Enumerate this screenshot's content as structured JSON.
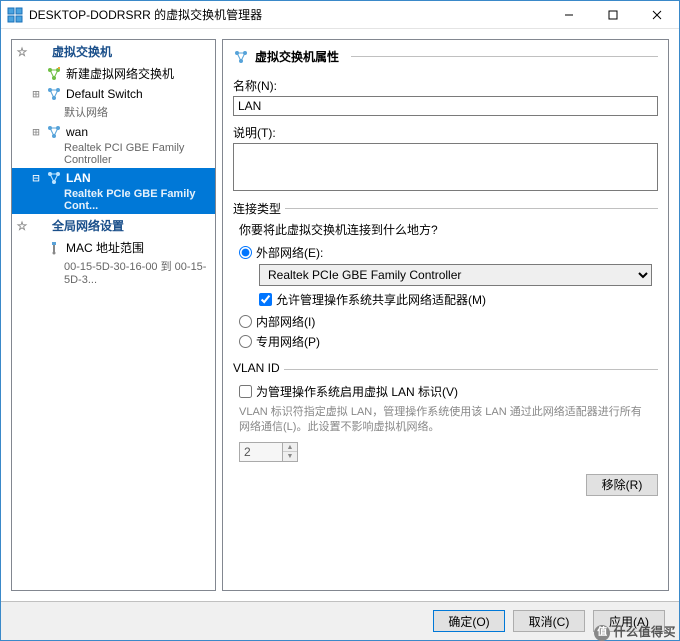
{
  "window": {
    "title": "DESKTOP-DODRSRR 的虚拟交换机管理器"
  },
  "tree": {
    "vswitch_header": "虚拟交换机",
    "new_vswitch": "新建虚拟网络交换机",
    "default_switch": "Default Switch",
    "default_switch_sub": "默认网络",
    "wan": "wan",
    "wan_sub": "Realtek PCI GBE Family Controller",
    "lan": "LAN",
    "lan_sub": "Realtek PCIe GBE Family Cont...",
    "global_header": "全局网络设置",
    "mac_range": "MAC 地址范围",
    "mac_range_sub": "00-15-5D-30-16-00 到 00-15-5D-3..."
  },
  "props": {
    "section_title": "虚拟交换机属性",
    "name_label": "名称(N):",
    "name_value": "LAN",
    "desc_label": "说明(T):",
    "desc_value": ""
  },
  "conn": {
    "legend": "连接类型",
    "question": "你要将此虚拟交换机连接到什么地方?",
    "external_label": "外部网络(E):",
    "adapter_value": "Realtek PCIe GBE Family Controller",
    "allow_share_label": "允许管理操作系统共享此网络适配器(M)",
    "internal_label": "内部网络(I)",
    "private_label": "专用网络(P)"
  },
  "vlan": {
    "legend": "VLAN ID",
    "enable_label": "为管理操作系统启用虚拟 LAN 标识(V)",
    "hint": "VLAN 标识符指定虚拟 LAN，管理操作系统使用该 LAN 通过此网络适配器进行所有网络通信(L)。此设置不影响虚拟机网络。",
    "id_value": "2"
  },
  "buttons": {
    "remove": "移除(R)",
    "ok": "确定(O)",
    "cancel": "取消(C)",
    "apply": "应用(A)"
  },
  "watermark": "什么值得买"
}
